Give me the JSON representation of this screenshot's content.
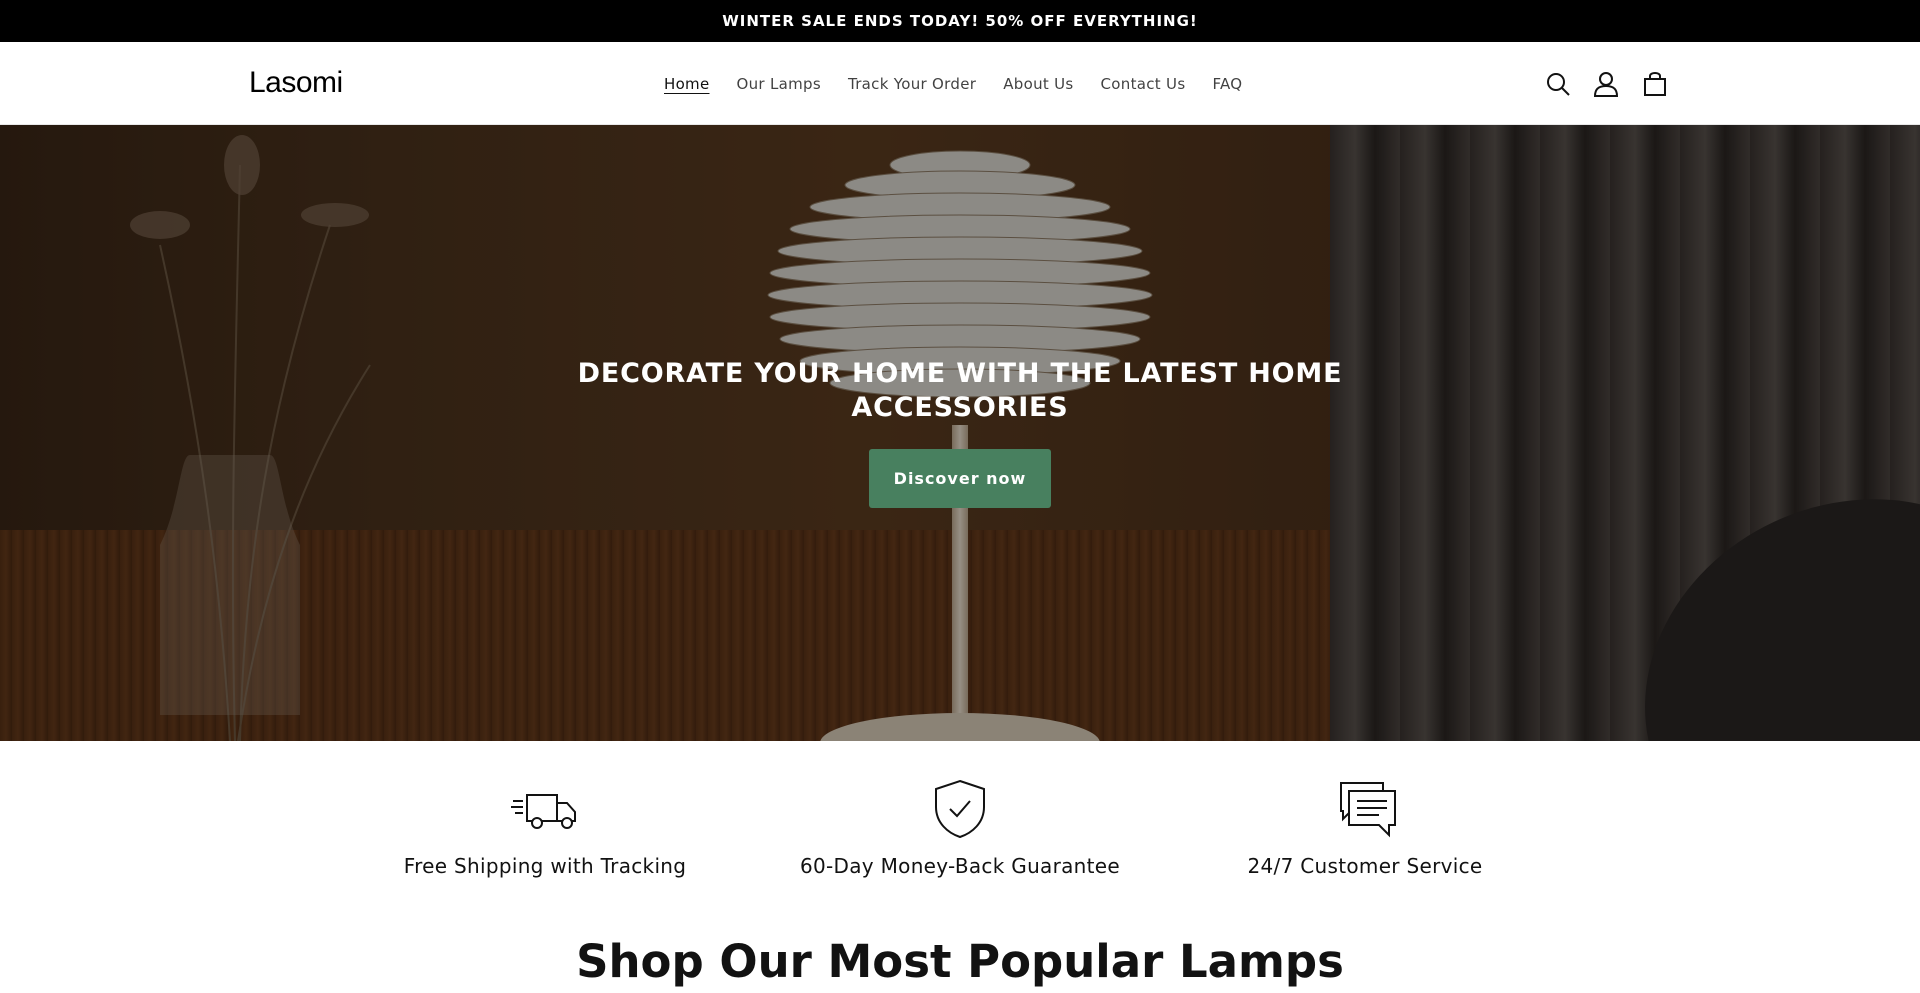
{
  "announcement": {
    "text": "WINTER SALE ENDS TODAY! 50% OFF EVERYTHING!"
  },
  "header": {
    "logo": "Lasomi",
    "nav": [
      "Home",
      "Our Lamps",
      "Track Your Order",
      "About Us",
      "Contact Us",
      "FAQ"
    ],
    "active_nav": "Home",
    "icons": [
      "search-icon",
      "account-icon",
      "cart-icon"
    ]
  },
  "hero": {
    "title": "DECORATE YOUR HOME WITH THE LATEST HOME ACCESSORIES",
    "button_label": "Discover now",
    "button_color": "#48805f"
  },
  "features": [
    {
      "icon": "truck-icon",
      "label": "Free Shipping with Tracking"
    },
    {
      "icon": "shield-check-icon",
      "label": "60-Day Money-Back Guarantee"
    },
    {
      "icon": "chat-bubbles-icon",
      "label": "24/7 Customer Service"
    }
  ],
  "section": {
    "title": "Shop Our Most Popular Lamps"
  }
}
